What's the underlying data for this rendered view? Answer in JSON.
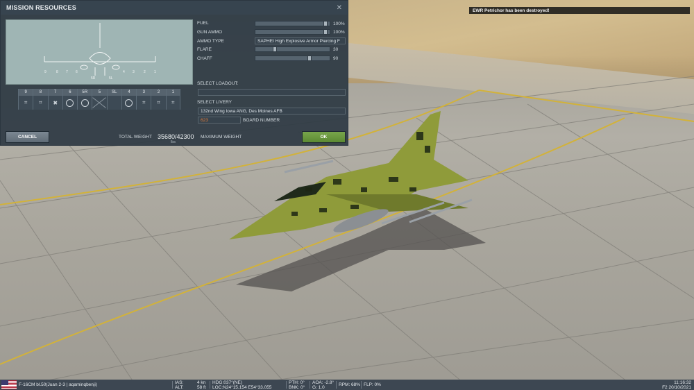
{
  "panel": {
    "title": "MISSION RESOURCES",
    "close_icon": "close-icon"
  },
  "pylons": [
    {
      "num": "9",
      "store": "launcher-icon"
    },
    {
      "num": "8",
      "store": "launcher-icon"
    },
    {
      "num": "7",
      "store": "pod-icon"
    },
    {
      "num": "6",
      "store": "tank-icon"
    },
    {
      "num": "5R",
      "store": "rack-icon"
    },
    {
      "num": "5",
      "store": "empty"
    },
    {
      "num": "SL",
      "store": "none"
    },
    {
      "num": "4",
      "store": "tank-icon"
    },
    {
      "num": "3",
      "store": "launcher-icon"
    },
    {
      "num": "2",
      "store": "launcher-icon"
    },
    {
      "num": "1",
      "store": "launcher-icon"
    }
  ],
  "fields": {
    "fuel": {
      "label": "FUEL",
      "value": "100%",
      "fraction": 0.97
    },
    "gun_ammo": {
      "label": "GUN AMMO",
      "value": "100%",
      "fraction": 0.97
    },
    "ammo_type": {
      "label": "AMMO TYPE",
      "value": "SAPHEI High Explosive Armor Piercing F"
    },
    "flare": {
      "label": "FLARE",
      "value": "30",
      "fraction": 0.25
    },
    "chaff": {
      "label": "CHAFF",
      "value": "90",
      "fraction": 0.74
    },
    "select_loadout": {
      "label": "SELECT LOADOUT:",
      "value": ""
    },
    "select_livery": {
      "label": "SELECT LIVERY",
      "value": "132nd Wing Iowa ANG, Des Moines AFB"
    },
    "board_number": {
      "label": "BOARD NUMBER",
      "value": "623"
    }
  },
  "weight": {
    "total_label": "TOTAL WEIGHT",
    "total_value": "35680/42300",
    "unit": "lbs",
    "max_label": "MAXIMUM WEIGHT"
  },
  "buttons": {
    "cancel": "CANCEL",
    "ok": "OK"
  },
  "notification": "EWR Petrichor has been destroyed!",
  "statusbar": {
    "aircraft": "F-16CM bl.50(Juan 2-3 | aqaminqbenji)",
    "ias_label": "IAS:",
    "ias_value": "4 kn",
    "alt_label": "ALT:",
    "alt_value": "58 ft",
    "hdg": "HDG:037°(NE)",
    "loc": "LOC:N24°15.154 E54°33.055",
    "pth": "PTH: 0°",
    "bnk": "BNK: 0°",
    "aoa": "AOA: -2.8°",
    "g": "G: 1.0",
    "rpm": "RPM: 68%",
    "flp": "FLP: 0%",
    "time": "11:16:32",
    "date": "F2 20/10/2021"
  },
  "colors": {
    "panel_bg": "#2e3a44",
    "ok_green": "#5c8a33",
    "board_number_orange": "#e07b3a"
  }
}
